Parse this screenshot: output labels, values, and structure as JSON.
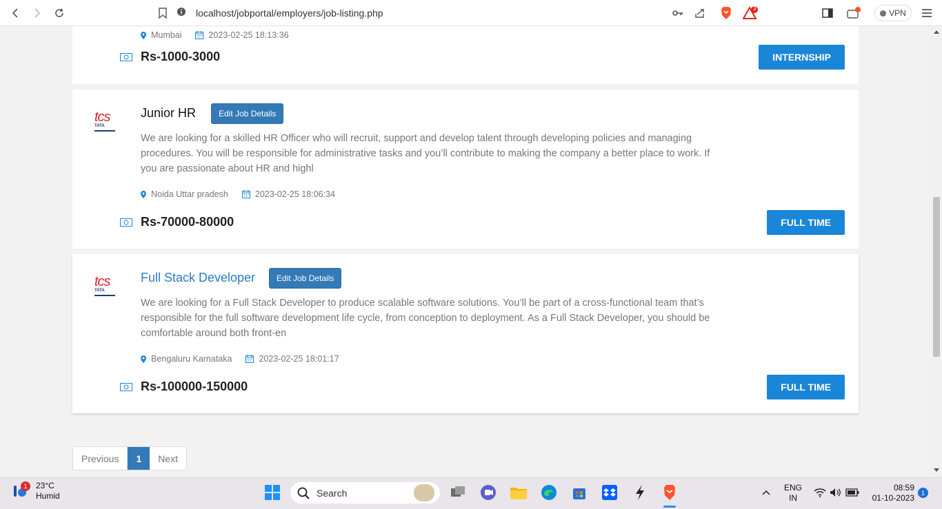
{
  "browser": {
    "url": "localhost/jobportal/employers/job-listing.php",
    "notification_count": "3",
    "vpn_label": "VPN"
  },
  "jobs": [
    {
      "title": "",
      "location": "Mumbai",
      "posted": "2023-02-25 18:13:36",
      "salary": "Rs-1000-3000",
      "type": "INTERNSHIP"
    },
    {
      "title": "Junior HR",
      "edit_label": "Edit Job Details",
      "description": "We are looking for a skilled HR Officer who will recruit, support and develop talent through developing policies and managing procedures. You will be responsible for administrative tasks and you’ll contribute to making the company a better place to work. If you are passionate about HR and highl",
      "location": "Noida Uttar pradesh",
      "posted": "2023-02-25 18:06:34",
      "salary": "Rs-70000-80000",
      "type": "FULL TIME",
      "logo_text": "tcs",
      "logo_sub": "TATA"
    },
    {
      "title": "Full Stack Developer",
      "edit_label": "Edit Job Details",
      "description": "We are looking for a Full Stack Developer to produce scalable software solutions. You’ll be part of a cross-functional team that’s responsible for the full software development life cycle, from conception to deployment. As a Full Stack Developer, you should be comfortable around both front-en",
      "location": "Bengaluru Karnataka",
      "posted": "2023-02-25 18:01:17",
      "salary": "Rs-100000-150000",
      "type": "FULL TIME",
      "logo_text": "tcs",
      "logo_sub": "TATA"
    }
  ],
  "pagination": {
    "previous": "Previous",
    "current": "1",
    "next": "Next"
  },
  "taskbar": {
    "weather_badge": "1",
    "temperature": "23°C",
    "condition": "Humid",
    "search_label": "Search",
    "language": "ENG",
    "region": "IN",
    "time": "08:59",
    "date": "01-10-2023",
    "notifications": "1"
  },
  "colors": {
    "accent_blue": "#1a86d8",
    "edit_blue": "#337ab7",
    "link_blue": "#2b7bc1",
    "brave_orange": "#fb542b",
    "tcs_red": "#d6282d"
  }
}
